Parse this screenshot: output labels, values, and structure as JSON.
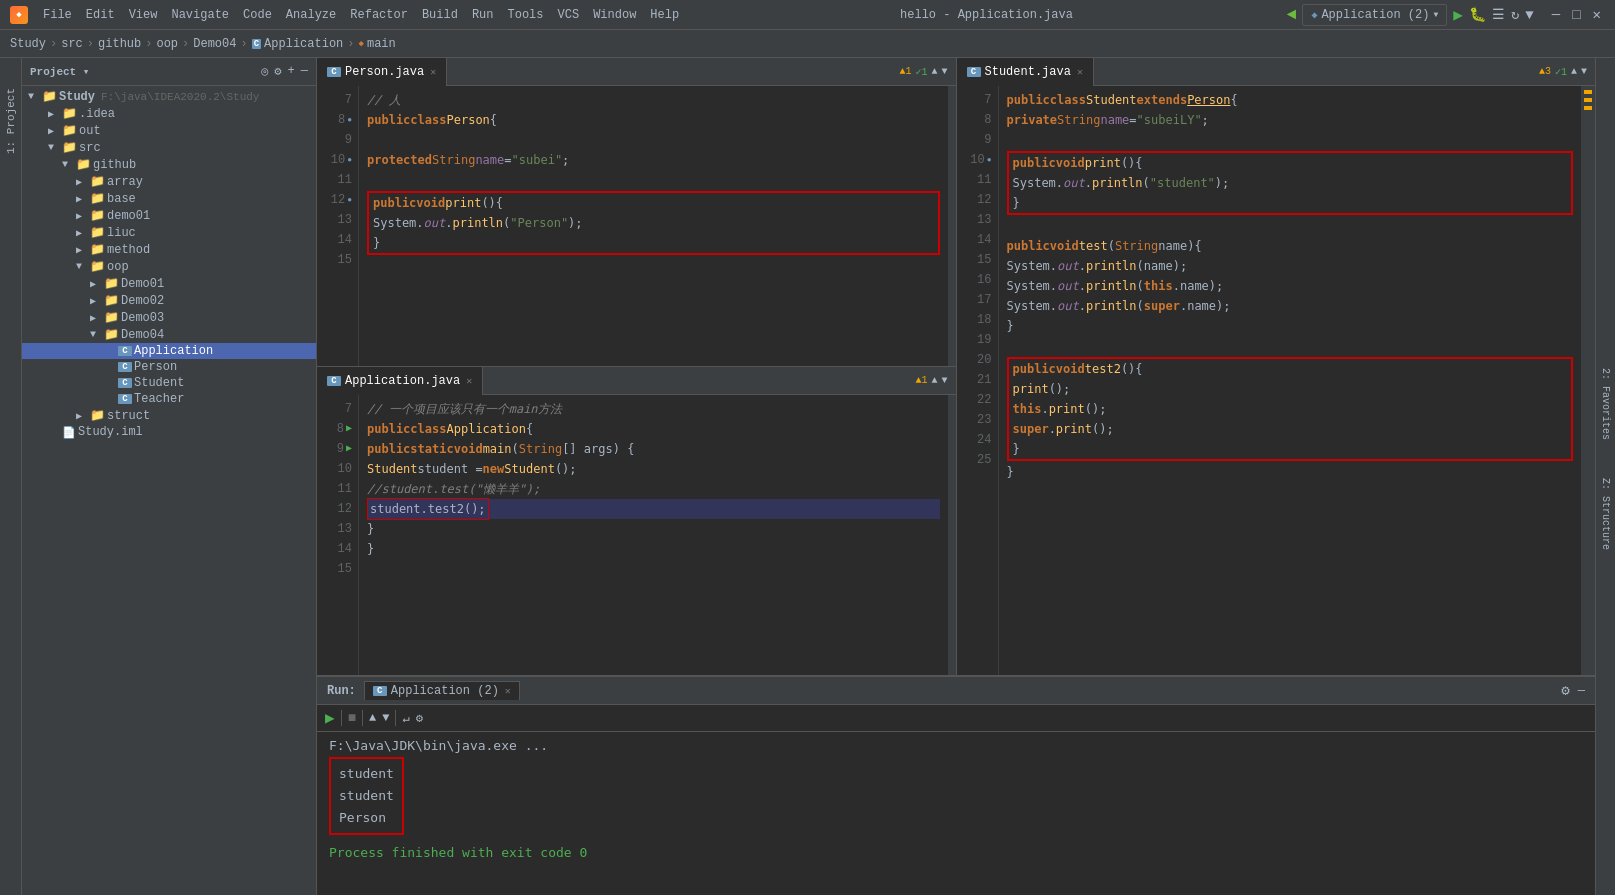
{
  "titlebar": {
    "title": "hello - Application.java",
    "menu_items": [
      "File",
      "Edit",
      "View",
      "Navigate",
      "Code",
      "Analyze",
      "Refactor",
      "Build",
      "Run",
      "Tools",
      "VCS",
      "Window",
      "Help"
    ],
    "win_min": "─",
    "win_max": "□",
    "win_close": "✕"
  },
  "breadcrumb": {
    "items": [
      "Study",
      "src",
      "github",
      "oop",
      "Demo04",
      "Application",
      "main"
    ],
    "separators": [
      ">",
      ">",
      ">",
      ">",
      ">",
      ">"
    ]
  },
  "sidebar": {
    "header": "Project",
    "root_name": "Study",
    "root_path": "F:\\java\\IDEA2020.2\\Study",
    "items": [
      {
        "name": "Study",
        "type": "root",
        "level": 0,
        "expanded": true
      },
      {
        "name": ".idea",
        "type": "folder",
        "level": 1,
        "expanded": false
      },
      {
        "name": "out",
        "type": "folder",
        "level": 1,
        "expanded": false
      },
      {
        "name": "src",
        "type": "folder",
        "level": 1,
        "expanded": true
      },
      {
        "name": "github",
        "type": "folder",
        "level": 2,
        "expanded": true
      },
      {
        "name": "array",
        "type": "folder",
        "level": 3,
        "expanded": false
      },
      {
        "name": "base",
        "type": "folder",
        "level": 3,
        "expanded": false
      },
      {
        "name": "demo01",
        "type": "folder",
        "level": 3,
        "expanded": false
      },
      {
        "name": "liuc",
        "type": "folder",
        "level": 3,
        "expanded": false
      },
      {
        "name": "method",
        "type": "folder",
        "level": 3,
        "expanded": false
      },
      {
        "name": "oop",
        "type": "folder",
        "level": 3,
        "expanded": true
      },
      {
        "name": "Demo01",
        "type": "folder",
        "level": 4,
        "expanded": false
      },
      {
        "name": "Demo02",
        "type": "folder",
        "level": 4,
        "expanded": false
      },
      {
        "name": "Demo03",
        "type": "folder",
        "level": 4,
        "expanded": false
      },
      {
        "name": "Demo04",
        "type": "folder",
        "level": 4,
        "expanded": true
      },
      {
        "name": "Application",
        "type": "class",
        "level": 5,
        "expanded": false,
        "selected": true
      },
      {
        "name": "Person",
        "type": "class",
        "level": 5,
        "expanded": false
      },
      {
        "name": "Student",
        "type": "class",
        "level": 5,
        "expanded": false
      },
      {
        "name": "Teacher",
        "type": "class",
        "level": 5,
        "expanded": false
      },
      {
        "name": "struct",
        "type": "folder",
        "level": 3,
        "expanded": false
      },
      {
        "name": "Study.iml",
        "type": "iml",
        "level": 1,
        "expanded": false
      }
    ]
  },
  "editor_left_top": {
    "tab_name": "Person.java",
    "tab_icon": "C",
    "lines": [
      {
        "num": 7,
        "code": "// 人"
      },
      {
        "num": 8,
        "code": "public class Person {",
        "has_bp": true
      },
      {
        "num": 9,
        "code": ""
      },
      {
        "num": 10,
        "code": "    protected String name = \"subei\";",
        "has_bp": true
      },
      {
        "num": 11,
        "code": ""
      },
      {
        "num": 12,
        "code": "    public void print(){",
        "has_bp": true,
        "in_box": true
      },
      {
        "num": 13,
        "code": "        System.out.println(\"Person\");",
        "in_box": true
      },
      {
        "num": 14,
        "code": "    }",
        "in_box": true
      },
      {
        "num": 15,
        "code": ""
      }
    ],
    "warnings": "▲1 ✓1"
  },
  "editor_left_bottom": {
    "tab_name": "Application.java",
    "tab_icon": "C",
    "lines": [
      {
        "num": 7,
        "code": "// 一个项目应该只有一个main方法"
      },
      {
        "num": 8,
        "code": "public class Application {",
        "has_exec": true
      },
      {
        "num": 9,
        "code": "    public static void main(String[] args) {",
        "has_exec": true
      },
      {
        "num": 10,
        "code": "        Student student = new Student();"
      },
      {
        "num": 11,
        "code": "        // student.test(\"懒羊羊\");"
      },
      {
        "num": 12,
        "code": "        student.test2();",
        "highlighted": true
      },
      {
        "num": 13,
        "code": "    }"
      },
      {
        "num": 14,
        "code": "}"
      },
      {
        "num": 15,
        "code": ""
      }
    ],
    "warnings": "▲1"
  },
  "editor_right": {
    "tab_name": "Student.java",
    "tab_icon": "C",
    "lines": [
      {
        "num": 7,
        "code": "public class Student extends Person {"
      },
      {
        "num": 8,
        "code": "    private String name = \"subeiLY\";"
      },
      {
        "num": 9,
        "code": ""
      },
      {
        "num": 10,
        "code": "    public void print(){",
        "has_bp": true,
        "box1_start": true
      },
      {
        "num": 11,
        "code": "        System.out.println(\"student\");",
        "in_box1": true
      },
      {
        "num": 12,
        "code": "    }",
        "box1_end": true
      },
      {
        "num": 13,
        "code": ""
      },
      {
        "num": 14,
        "code": "    public void test(String name){"
      },
      {
        "num": 15,
        "code": "        System.out.println(name);"
      },
      {
        "num": 16,
        "code": "        System.out.println(this.name);"
      },
      {
        "num": 17,
        "code": "        System.out.println(super.name);"
      },
      {
        "num": 18,
        "code": "    }"
      },
      {
        "num": 19,
        "code": ""
      },
      {
        "num": 20,
        "code": "    public void test2(){",
        "box2_start": true
      },
      {
        "num": 21,
        "code": "        print();",
        "in_box2": true
      },
      {
        "num": 22,
        "code": "        this.print();",
        "in_box2": true
      },
      {
        "num": 23,
        "code": "        super.print();",
        "in_box2": true
      },
      {
        "num": 24,
        "code": "    }",
        "box2_end": true
      },
      {
        "num": 25,
        "code": "}"
      }
    ],
    "warnings": "▲3 ✓1"
  },
  "run_panel": {
    "label": "Run:",
    "tab_label": "Application (2)",
    "run_path": "F:\\Java\\JDK\\bin\\java.exe ...",
    "output_lines": [
      "student",
      "student",
      "Person"
    ],
    "exit_message": "Process finished with exit code 0"
  },
  "toolbar": {
    "run_config": "Application (2)",
    "run_icon": "▶",
    "build_icon": "🔨",
    "sync_icon": "↻",
    "back_nav": "◀",
    "fwd_nav": "▶"
  }
}
